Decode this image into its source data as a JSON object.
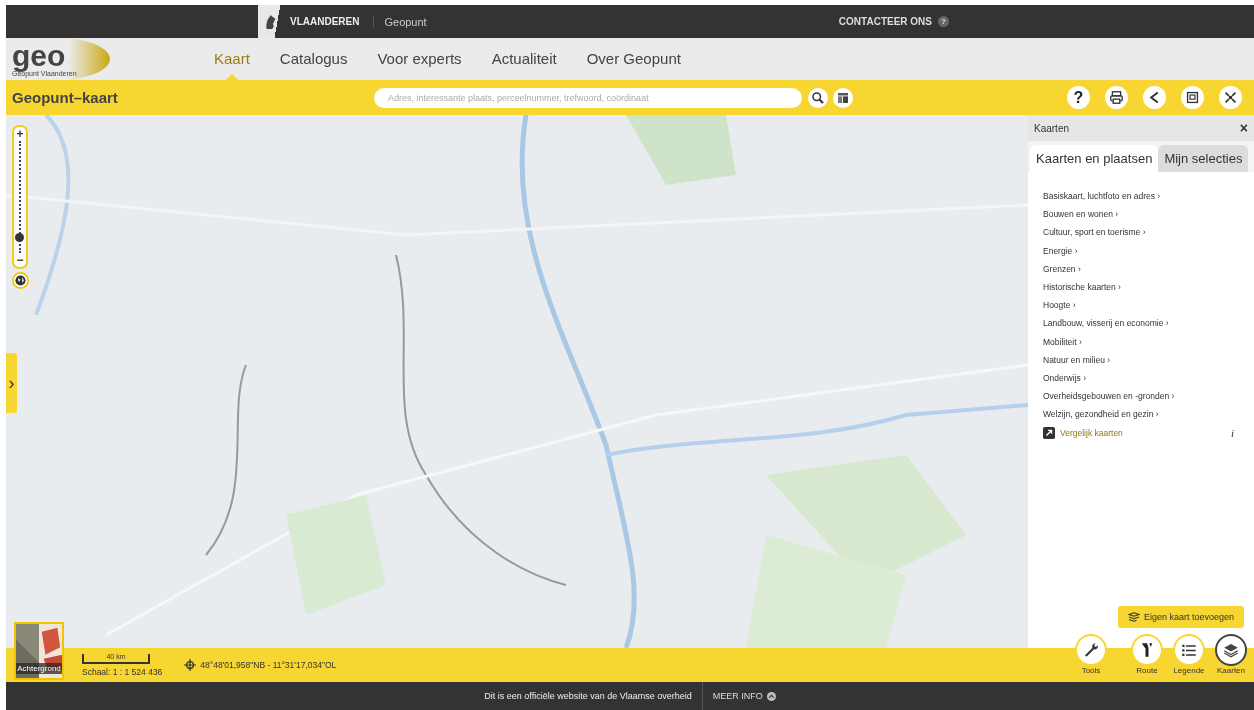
{
  "top_bar": {
    "brand": "VLAANDEREN",
    "site": "Geopunt",
    "contact": "CONTACTEER ONS",
    "contact_help": "?"
  },
  "logo": {
    "text": "geo",
    "subtitle": "Geopunt Vlaanderen"
  },
  "nav": [
    {
      "label": "Kaart",
      "selected": true
    },
    {
      "label": "Catalogus",
      "selected": false
    },
    {
      "label": "Voor experts",
      "selected": false
    },
    {
      "label": "Actualiteit",
      "selected": false
    },
    {
      "label": "Over Geopunt",
      "selected": false
    }
  ],
  "toolbar": {
    "title": "Geopunt–kaart",
    "search": {
      "placeholder": "Adres, interessante plaats, perceelnummer, trefwoord, coördinaat"
    },
    "help": "?"
  },
  "map": {
    "zoom_slider": {
      "plus": "+",
      "minus": "−",
      "level": 0.1
    },
    "expand": "›"
  },
  "panel": {
    "title": "Kaarten",
    "close": "×",
    "tabs": [
      {
        "label": "Kaarten en plaatsen",
        "selected": true
      },
      {
        "label": "Mijn selecties",
        "selected": false
      }
    ],
    "items": [
      "Basiskaart, luchtfoto en adres ›",
      "Bouwen en wonen ›",
      "Cultuur, sport en toerisme ›",
      "Energie ›",
      "Grenzen ›",
      "Historische kaarten ›",
      "Hoogte ›",
      "Landbouw, visserij en economie ›",
      "Mobiliteit ›",
      "Natuur en milieu ›",
      "Onderwijs ›",
      "Overheidsgebouwen en -gronden ›",
      "Welzijn, gezondheid en gezin ›"
    ],
    "compare": "Vergelijk kaarten",
    "info": "i",
    "add_button": "Eigen kaart toevoegen"
  },
  "status": {
    "background": "Achtergrond",
    "scale_bar": "40 km",
    "scale": "Schaal: 1 : 1 524 436",
    "coordinates": "48°48'01,958\"NB - 11°31'17,034\"OL"
  },
  "tools": [
    {
      "label": "Tools",
      "kind": "wrench",
      "selected": false
    },
    {
      "label": "Route",
      "kind": "route",
      "selected": false
    },
    {
      "label": "Legende",
      "kind": "list",
      "selected": false
    },
    {
      "label": "Kaarten",
      "kind": "layers",
      "selected": true
    }
  ],
  "footer": {
    "text": "Dit is een officiële website van de Vlaamse overheid",
    "more": "MEER INFO"
  }
}
